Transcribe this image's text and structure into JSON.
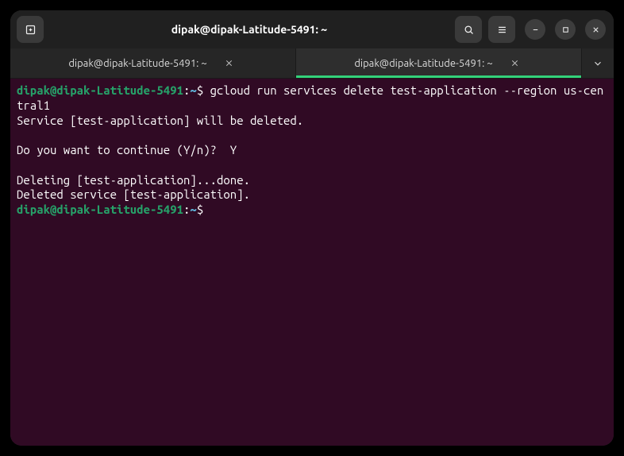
{
  "titlebar": {
    "title": "dipak@dipak-Latitude-5491: ~"
  },
  "tabs": [
    {
      "label": "dipak@dipak-Latitude-5491: ~",
      "active": false
    },
    {
      "label": "dipak@dipak-Latitude-5491: ~",
      "active": true
    }
  ],
  "prompt": {
    "user_host": "dipak@dipak-Latitude-5491",
    "colon": ":",
    "path": "~",
    "symbol": "$"
  },
  "terminal": {
    "line1_cmd": " gcloud run services delete test-application --region us-central1",
    "line2": "Service [test-application] will be deleted.",
    "blank": "",
    "line3": "Do you want to continue (Y/n)?  Y",
    "line4": "Deleting [test-application]...done.",
    "line5": "Deleted service [test-application].",
    "trailing": " "
  }
}
